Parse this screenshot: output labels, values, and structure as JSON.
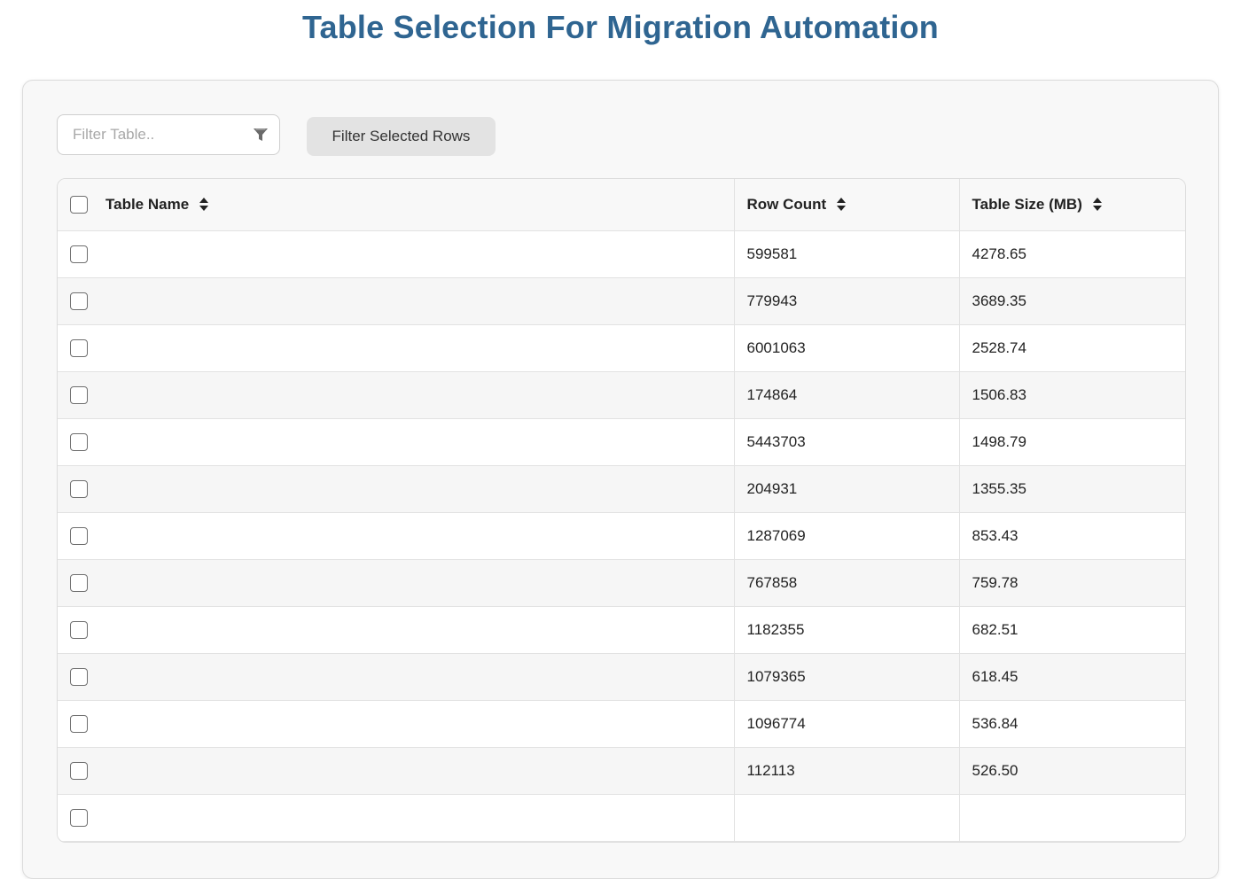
{
  "page": {
    "title": "Table Selection For Migration Automation"
  },
  "toolbar": {
    "filter_placeholder": "Filter Table..",
    "filter_icon": "funnel-icon",
    "filter_selected_label": "Filter Selected Rows"
  },
  "table": {
    "columns": {
      "name": "Table Name",
      "row_count": "Row Count",
      "size": "Table Size (MB)"
    },
    "sort_icon": "sort-up-down-icon",
    "rows": [
      {
        "name": "",
        "row_count": "599581",
        "size": "4278.65"
      },
      {
        "name": "",
        "row_count": "779943",
        "size": "3689.35"
      },
      {
        "name": "",
        "row_count": "6001063",
        "size": "2528.74"
      },
      {
        "name": "",
        "row_count": "174864",
        "size": "1506.83"
      },
      {
        "name": "",
        "row_count": "5443703",
        "size": "1498.79"
      },
      {
        "name": "",
        "row_count": "204931",
        "size": "1355.35"
      },
      {
        "name": "",
        "row_count": "1287069",
        "size": "853.43"
      },
      {
        "name": "",
        "row_count": "767858",
        "size": "759.78"
      },
      {
        "name": "",
        "row_count": "1182355",
        "size": "682.51"
      },
      {
        "name": "",
        "row_count": "1079365",
        "size": "618.45"
      },
      {
        "name": "",
        "row_count": "1096774",
        "size": "536.84"
      },
      {
        "name": "",
        "row_count": "112113",
        "size": "526.50"
      },
      {
        "name": "",
        "row_count": "",
        "size": ""
      }
    ]
  },
  "colors": {
    "title": "#2f6591",
    "panel_bg": "#f8f8f8",
    "button_bg": "#e3e3e3",
    "stripe": "#f6f6f6"
  }
}
